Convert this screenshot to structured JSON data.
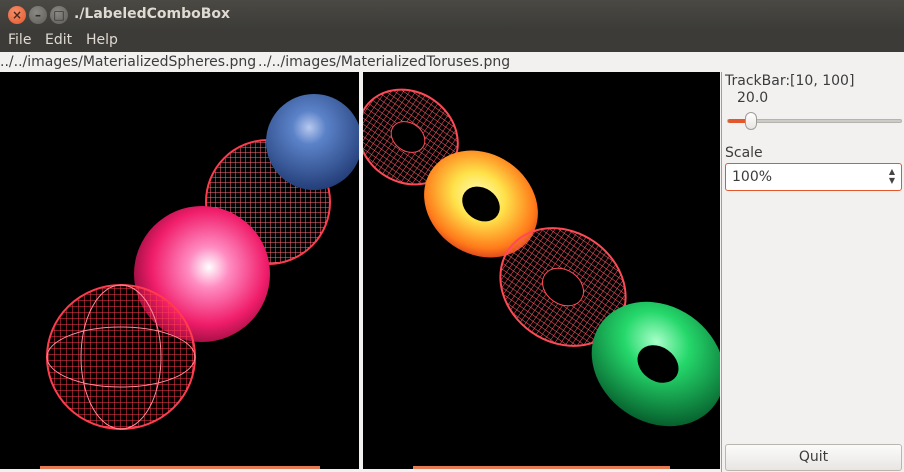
{
  "window": {
    "title": "./LabeledComboBox"
  },
  "menu": [
    "File",
    "Edit",
    "Help"
  ],
  "paths": {
    "left": "../../images/MaterializedSpheres.png",
    "right": "../../images/MaterializedToruses.png"
  },
  "trackbar": {
    "label": "TrackBar:[10, 100]",
    "value": "20.0",
    "min": 10,
    "max": 100,
    "current": 20
  },
  "scale": {
    "label": "Scale",
    "selected": "100%"
  },
  "quit_label": "Quit",
  "colors": {
    "accent": "#e2572b",
    "canvas": "#000000"
  }
}
